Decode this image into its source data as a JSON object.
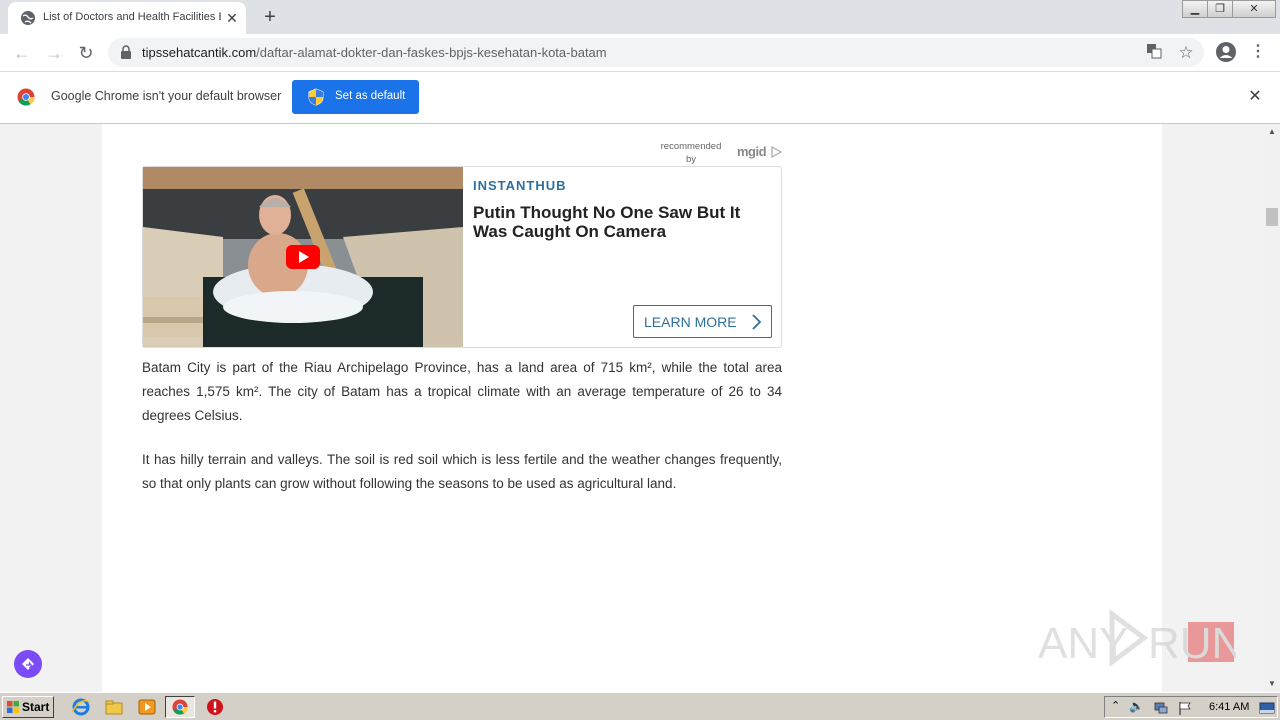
{
  "browser": {
    "tab_title": "List of Doctors and Health Facilities BPJS",
    "new_tab_label": "+",
    "url_domain": "tipssehatcantik.com",
    "url_path": "/daftar-alamat-dokter-dan-faskes-bpjs-kesehatan-kota-batam",
    "window_controls": [
      "minimize",
      "restore",
      "close"
    ]
  },
  "infobar": {
    "message": "Google Chrome isn't your default browser",
    "button_label": "Set as default"
  },
  "ad": {
    "recommended_by": "recommended by",
    "network": "mgid",
    "source": "INSTANTHUB",
    "headline": "Putin Thought No One Saw But It Was Caught On Camera",
    "cta": "LEARN MORE"
  },
  "article": {
    "paragraph1": "Batam City is part of the Riau Archipelago Province, has a land area of 715 km², while the total area reaches 1,575 km². The city of Batam has a tropical climate with an average temperature of 26 to 34 degrees Celsius.",
    "paragraph2": "It has hilly terrain and valleys. The soil is red soil which is less fertile and the weather changes frequently, so that only plants can grow without following the seasons to be used as agricultural land."
  },
  "watermark": {
    "text_left": "ANY",
    "text_right": "RUN"
  },
  "taskbar": {
    "start_label": "Start",
    "clock": "6:41 AM"
  },
  "colors": {
    "chrome_blue": "#1a73e8",
    "ad_accent": "#2e6f9e",
    "float_button": "#7b4cf5"
  }
}
